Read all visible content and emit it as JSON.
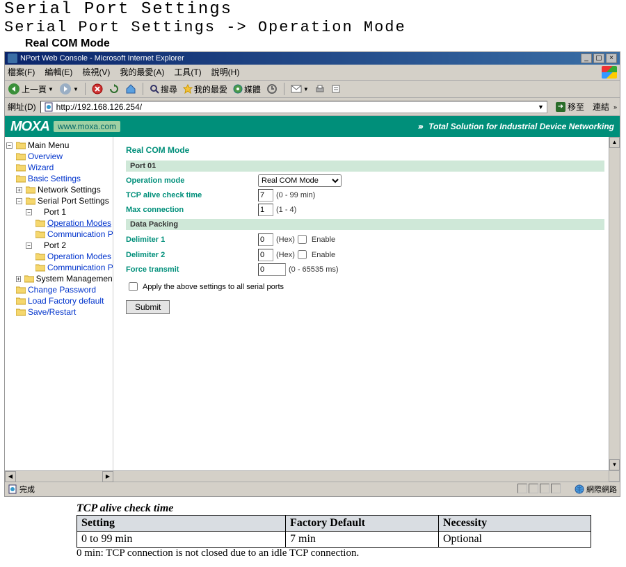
{
  "doc": {
    "title": "Serial Port Settings",
    "subtitle": "Serial Port Settings -> Operation Mode",
    "mode_label": "Real COM Mode"
  },
  "browser": {
    "window_title": "NPort Web Console - Microsoft Internet Explorer",
    "menu": [
      "檔案(F)",
      "編輯(E)",
      "檢視(V)",
      "我的最愛(A)",
      "工具(T)",
      "說明(H)"
    ],
    "toolbar": {
      "back": "上一頁",
      "search": "搜尋",
      "favorites": "我的最愛",
      "media": "媒體"
    },
    "address_label": "網址(D)",
    "url": "http://192.168.126.254/",
    "go_label": "移至",
    "links_label": "連結"
  },
  "banner": {
    "logo_text": "MOXA",
    "logo_url": "www.moxa.com",
    "tagline": "Total Solution for Industrial Device Networking"
  },
  "tree": {
    "root": "Main Menu",
    "overview": "Overview",
    "wizard": "Wizard",
    "basic": "Basic Settings",
    "network": "Network Settings",
    "serial": "Serial Port Settings",
    "port1": "Port 1",
    "op_modes": "Operation Modes",
    "comm_para": "Communication Para",
    "port2": "Port 2",
    "sysmgmt": "System Management",
    "changepw": "Change Password",
    "loadfac": "Load Factory default",
    "saverestart": "Save/Restart"
  },
  "form": {
    "page_heading": "Real COM Mode",
    "port_bar": "Port 01",
    "op_mode_label": "Operation mode",
    "op_mode_value": "Real COM Mode",
    "tcp_alive_label": "TCP alive check time",
    "tcp_alive_value": "7",
    "tcp_alive_hint": "(0 - 99 min)",
    "maxconn_label": "Max connection",
    "maxconn_value": "1",
    "maxconn_hint": "(1 - 4)",
    "datapacking_bar": "Data Packing",
    "delim1_label": "Delimiter 1",
    "delim1_value": "0",
    "delim2_label": "Delimiter 2",
    "delim2_value": "0",
    "hex_hint": "(Hex)",
    "enable_label": "Enable",
    "force_label": "Force transmit",
    "force_value": "0",
    "force_hint": "(0 - 65535 ms)",
    "apply_all": "Apply the above settings to all serial ports",
    "submit": "Submit"
  },
  "status": {
    "done": "完成",
    "zone": "網際網路"
  },
  "table": {
    "caption": "TCP alive check time",
    "h1": "Setting",
    "h2": "Factory Default",
    "h3": "Necessity",
    "r1c1": "0 to 99 min",
    "r1c2": "7 min",
    "r1c3": "Optional",
    "note": "0 min: TCP connection is not closed due to an idle TCP connection."
  }
}
